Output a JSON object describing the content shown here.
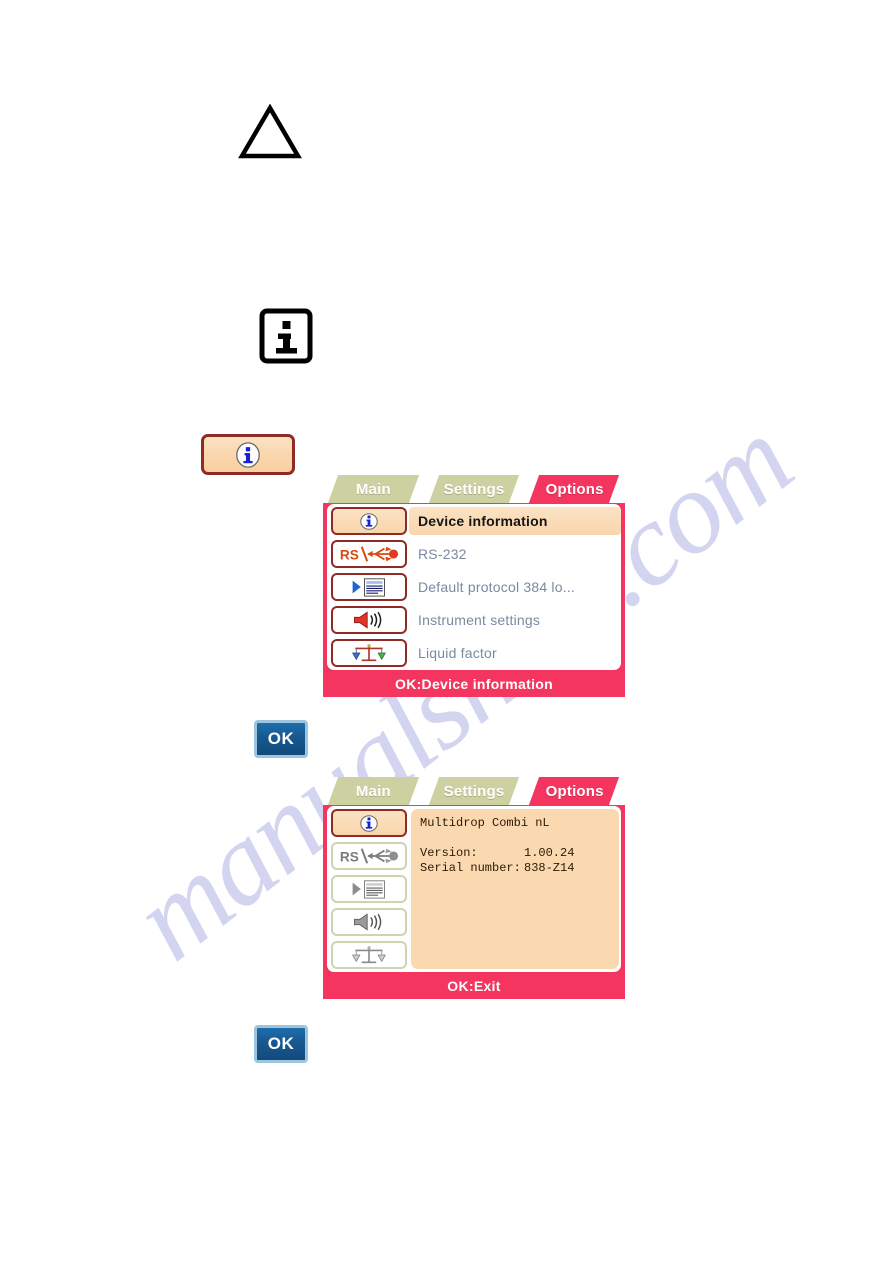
{
  "watermark": {
    "text": "manualshive.com"
  },
  "callouts": {
    "warning_icon": "warning-triangle-icon",
    "note_icon": "info-box-icon",
    "info_key_icon": "info-circle-icon",
    "ok_key_label": "OK"
  },
  "screens": [
    {
      "id": "options-menu",
      "tabs": [
        {
          "label": "Main",
          "active": false
        },
        {
          "label": "Settings",
          "active": false
        },
        {
          "label": "Options",
          "active": true
        }
      ],
      "menu_items": [
        {
          "label": "Device information",
          "icon": "info-circle-icon",
          "selected": true
        },
        {
          "label": "RS-232",
          "icon": "rs232-icon",
          "selected": false
        },
        {
          "label": "Default protocol 384 lo...",
          "icon": "protocol-list-icon",
          "selected": false
        },
        {
          "label": "Instrument settings",
          "icon": "speaker-icon",
          "selected": false
        },
        {
          "label": "Liquid factor",
          "icon": "balance-scale-icon",
          "selected": false
        }
      ],
      "status": "OK:Device information"
    },
    {
      "id": "device-information",
      "tabs": [
        {
          "label": "Main",
          "active": false
        },
        {
          "label": "Settings",
          "active": false
        },
        {
          "label": "Options",
          "active": true
        }
      ],
      "icons": [
        {
          "icon": "info-circle-icon",
          "selected": true
        },
        {
          "icon": "rs232-icon",
          "selected": false
        },
        {
          "icon": "protocol-list-icon",
          "selected": false
        },
        {
          "icon": "speaker-icon",
          "selected": false
        },
        {
          "icon": "balance-scale-icon",
          "selected": false
        }
      ],
      "info": {
        "model": "Multidrop Combi nL",
        "version_label": "Version:",
        "version_value": "1.00.24",
        "serial_label": "Serial number:",
        "serial_value": "838-Z14"
      },
      "status": "OK:Exit"
    }
  ],
  "colors": {
    "screen_red": "#f4355f",
    "tab_olive": "#cdd0a0",
    "selection_peach": "#fbe3c2",
    "panel_peach": "#fbd9b0",
    "icon_border": "#8f2a26",
    "ok_blue": "#17588f",
    "watermark_blue": "#b9bbe8"
  }
}
